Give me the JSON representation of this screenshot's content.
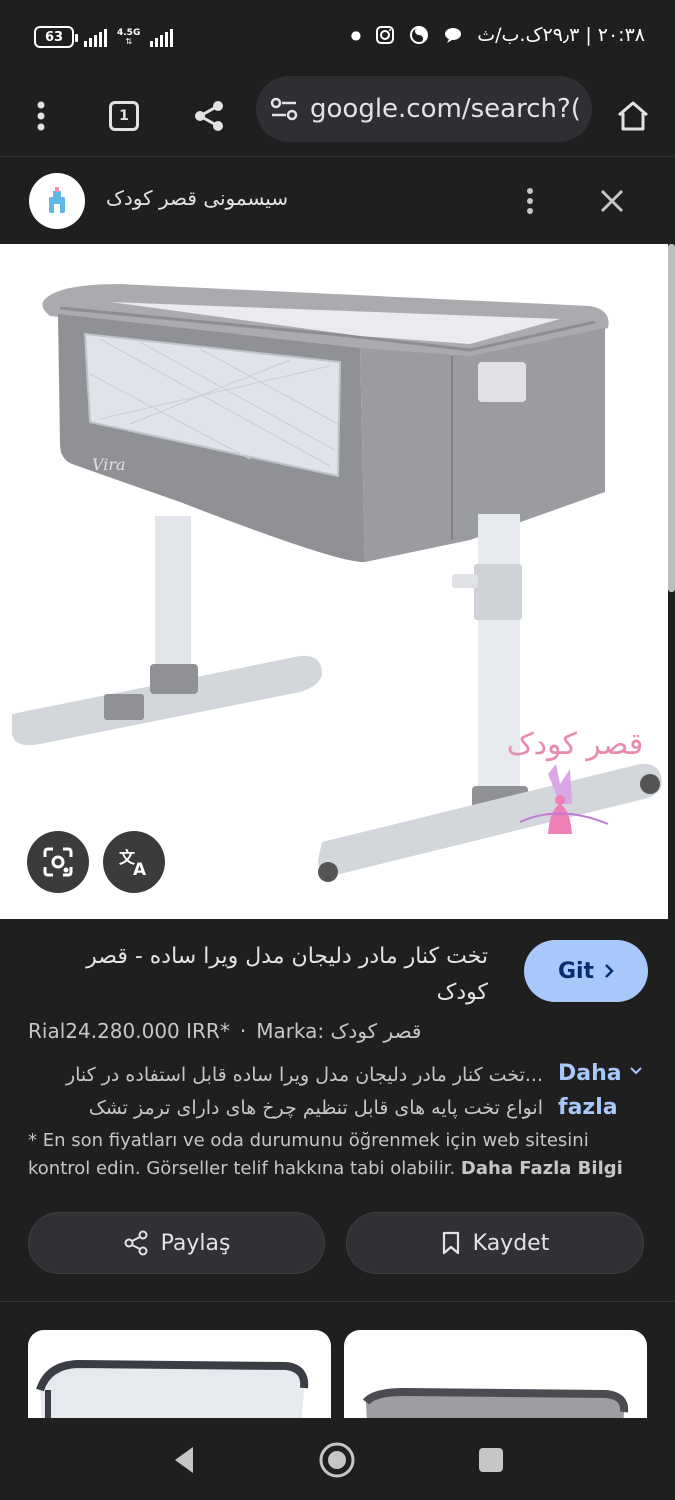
{
  "status_bar": {
    "battery": "63",
    "network": "4.5G",
    "clock": "۲۰:۳۸ | ۲۹٫۳ک.ب/ث"
  },
  "browser": {
    "tab_count": "1",
    "url": "google.com/search?("
  },
  "sheet": {
    "site_name": "سیسمونی قصر کودک"
  },
  "product": {
    "title": "تخت کنار مادر دلیجان مدل ویرا ساده - قصر کودک",
    "visit_label": "Git",
    "price": "Rial24.280.000 IRR*",
    "brand_prefix": "Marka:",
    "brand_name": "قصر کودک",
    "description": "...تخت کنار مادر دلیجان مدل ویرا ساده قابل استفاده در کنار انواع تخت پایه های قابل تنظیم چرخ های دارای ترمز تشک",
    "more_label": "Daha fazla",
    "disclaimer": "* En son fiyatları ve oda durumunu öğrenmek için web sitesini kontrol edin. Görseller telif hakkına tabi olabilir.",
    "disclaimer_link": "Daha Fazla Bilgi",
    "share_label": "Paylaş",
    "save_label": "Kaydet"
  },
  "image": {
    "brand_text": "Vira",
    "watermark_text": "قصر کودک"
  },
  "colors": {
    "background": "#1f1f1f",
    "accent": "#a8c7fa",
    "link": "#a8c7fa"
  }
}
